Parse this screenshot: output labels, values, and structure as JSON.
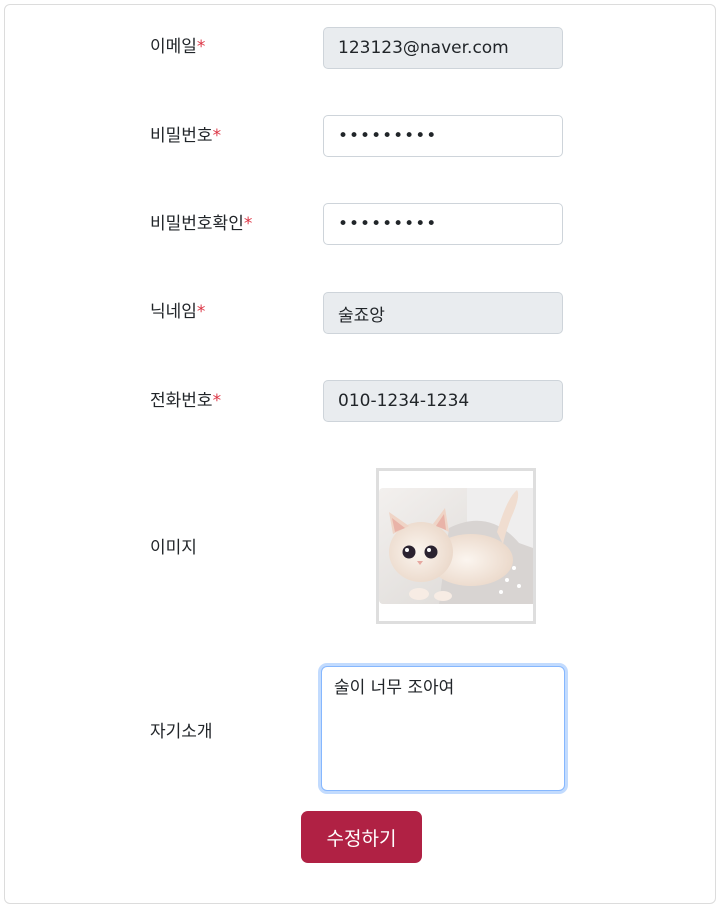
{
  "form": {
    "required_marker": "*",
    "email": {
      "label": "이메일",
      "value": "123123@naver.com"
    },
    "password": {
      "label": "비밀번호",
      "value": "123123123"
    },
    "password_confirm": {
      "label": "비밀번호확인",
      "value": "123123123"
    },
    "nickname": {
      "label": "닉네임",
      "value": "술죠앙"
    },
    "phone": {
      "label": "전화번호",
      "value": "010-1234-1234"
    },
    "image": {
      "label": "이미지"
    },
    "intro": {
      "label": "자기소개",
      "value": "술이 너무 조아여"
    },
    "submit_label": "수정하기"
  },
  "colors": {
    "accent": "#b02144",
    "required": "#dc3545",
    "readonly_bg": "#e9ecef",
    "focus_border": "#86b7fe"
  }
}
